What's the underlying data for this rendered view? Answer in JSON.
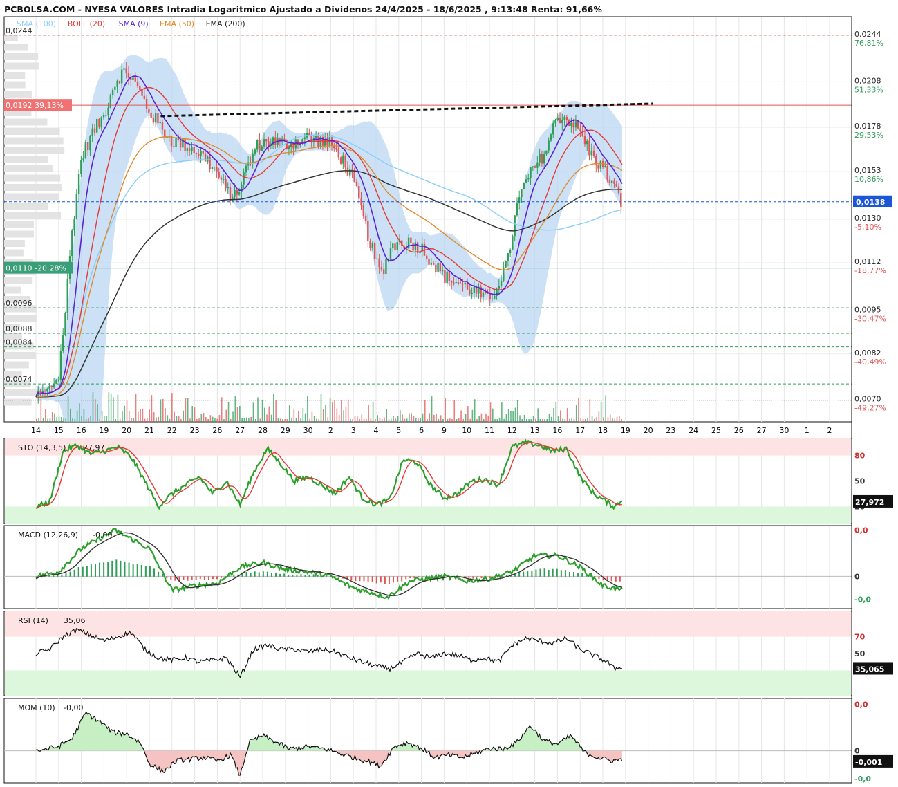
{
  "title": "PCBOLSA.COM - NYESA VALORES Intradia Logaritmico Ajustado a Dividenos 24/4/2025 - 18/6/2025 , 9:13:48 Renta: 91,66%",
  "colors": {
    "sma100": "#87cefa",
    "boll": "#e53935",
    "sma9": "#5b21d6",
    "ema50": "#e08a2a",
    "ema200": "#333333",
    "green": "#2e9e58",
    "red": "#e05555",
    "band": "#b7d4f2"
  },
  "legend": [
    {
      "text": "SMA (100)",
      "color": "#87cefa"
    },
    {
      "text": "BOLL (20)",
      "color": "#e53935"
    },
    {
      "text": "SMA (9)",
      "color": "#5b21d6"
    },
    {
      "text": "EMA (50)",
      "color": "#e08a2a"
    },
    {
      "text": "EMA (200)",
      "color": "#222222"
    }
  ],
  "chart_data": [
    {
      "type": "line",
      "name": "price",
      "scale": "log",
      "ylim": [
        0.0065,
        0.026
      ],
      "y_ticks": [
        {
          "value": 0.0244,
          "label": "0,0244",
          "pct": "76,81%",
          "pctColor": "#2e9e58"
        },
        {
          "value": 0.0208,
          "label": "0,0208",
          "pct": "51,33%",
          "pctColor": "#2e9e58"
        },
        {
          "value": 0.0178,
          "label": "0,0178",
          "pct": "29,53%",
          "pctColor": "#2e9e58"
        },
        {
          "value": 0.0153,
          "label": "0,0153",
          "pct": "10,86%",
          "pctColor": "#2e9e58"
        },
        {
          "value": 0.013,
          "label": "0,0130",
          "pct": "-5,10%",
          "pctColor": "#e05555"
        },
        {
          "value": 0.0112,
          "label": "0,0112",
          "pct": "-18,77%",
          "pctColor": "#e05555"
        },
        {
          "value": 0.0095,
          "label": "0,0095",
          "pct": "-30,47%",
          "pctColor": "#e05555"
        },
        {
          "value": 0.0082,
          "label": "0,0082",
          "pct": "-40,49%",
          "pctColor": "#e05555"
        },
        {
          "value": 0.007,
          "label": "0,0070",
          "pct": "-49,27%",
          "pctColor": "#e05555"
        }
      ],
      "left_levels": [
        {
          "value": 0.0244,
          "label": "0,0244",
          "style": "dash",
          "color": "#e05555"
        },
        {
          "value": 0.0096,
          "label": "0,0096",
          "style": "dash",
          "color": "#2e9e58"
        },
        {
          "value": 0.0088,
          "label": "0,0088",
          "style": "dash",
          "color": "#2e9e58"
        },
        {
          "value": 0.0084,
          "label": "0,0084",
          "style": "dash",
          "color": "#2e9e58"
        },
        {
          "value": 0.0074,
          "label": "0,0074",
          "style": "dash",
          "color": "#2e9e58"
        }
      ],
      "resistance": {
        "value": 0.0192,
        "label": "0,0192  39,13%",
        "color": "#e05555"
      },
      "support": {
        "value": 0.011,
        "label": "0,0110  -20,28%",
        "color": "#2e9e58"
      },
      "current": {
        "value": 0.0138,
        "label": "0,0138",
        "color": "#1a56d6"
      },
      "base": {
        "value": 0.007
      },
      "x_labels": [
        "14",
        "15",
        "16",
        "19",
        "20",
        "21",
        "22",
        "23",
        "26",
        "27",
        "28",
        "29",
        "30",
        "2",
        "3",
        "4",
        "5",
        "6",
        "9",
        "10",
        "11",
        "12",
        "13",
        "16",
        "17",
        "18",
        "19",
        "20",
        "23",
        "24",
        "25",
        "26",
        "27",
        "30",
        "1",
        "2"
      ],
      "last_data_index": 25,
      "close_keys": [
        [
          0,
          0.0071
        ],
        [
          0.5,
          0.0072
        ],
        [
          1.0,
          0.0076
        ],
        [
          1.3,
          0.0095
        ],
        [
          1.6,
          0.0125
        ],
        [
          2.0,
          0.016
        ],
        [
          2.5,
          0.0175
        ],
        [
          3.0,
          0.0185
        ],
        [
          3.4,
          0.0205
        ],
        [
          3.8,
          0.0215
        ],
        [
          4.2,
          0.0212
        ],
        [
          4.6,
          0.02
        ],
        [
          5.0,
          0.0188
        ],
        [
          5.5,
          0.0178
        ],
        [
          6.0,
          0.017
        ],
        [
          6.5,
          0.0168
        ],
        [
          7.0,
          0.0165
        ],
        [
          7.5,
          0.016
        ],
        [
          8.0,
          0.0152
        ],
        [
          8.4,
          0.0143
        ],
        [
          8.8,
          0.014
        ],
        [
          9.3,
          0.0155
        ],
        [
          9.8,
          0.0168
        ],
        [
          10.3,
          0.017
        ],
        [
          11.0,
          0.0168
        ],
        [
          11.5,
          0.017
        ],
        [
          12.0,
          0.0172
        ],
        [
          12.5,
          0.017
        ],
        [
          13.0,
          0.0168
        ],
        [
          13.5,
          0.016
        ],
        [
          14.0,
          0.0148
        ],
        [
          14.5,
          0.0128
        ],
        [
          15.0,
          0.0112
        ],
        [
          15.3,
          0.0107
        ],
        [
          15.6,
          0.0118
        ],
        [
          16.0,
          0.012
        ],
        [
          16.5,
          0.012
        ],
        [
          17.0,
          0.0118
        ],
        [
          17.5,
          0.0112
        ],
        [
          18.0,
          0.0107
        ],
        [
          18.5,
          0.0105
        ],
        [
          19.0,
          0.0103
        ],
        [
          19.5,
          0.0101
        ],
        [
          20.0,
          0.0098
        ],
        [
          20.4,
          0.0105
        ],
        [
          20.8,
          0.0112
        ],
        [
          21.2,
          0.0135
        ],
        [
          21.6,
          0.0148
        ],
        [
          22.0,
          0.0155
        ],
        [
          22.5,
          0.0165
        ],
        [
          23.0,
          0.0185
        ],
        [
          23.5,
          0.0183
        ],
        [
          24.0,
          0.0175
        ],
        [
          24.5,
          0.0162
        ],
        [
          25.0,
          0.0155
        ],
        [
          25.5,
          0.0145
        ],
        [
          25.8,
          0.0138
        ]
      ],
      "dashed_trend": [
        [
          5.5,
          0.0185
        ],
        [
          27.2,
          0.0193
        ]
      ]
    },
    {
      "type": "line",
      "name": "STO (14,3,5)",
      "label": "STO (14,3,5)",
      "value_text": "27,97",
      "current": "27,972",
      "ylim": [
        0,
        100
      ],
      "zones": [
        [
          80,
          100,
          "#fde3e3"
        ],
        [
          0,
          20,
          "#ddf7dc"
        ]
      ],
      "ticks": [
        {
          "v": 80,
          "label": "80",
          "color": "#d32f2f"
        },
        {
          "v": 50,
          "label": "50",
          "color": "#333"
        },
        {
          "v": 20,
          "label": "20",
          "color": "#333"
        }
      ],
      "keys": [
        [
          0,
          20
        ],
        [
          0.6,
          25
        ],
        [
          1.2,
          85
        ],
        [
          1.8,
          92
        ],
        [
          2.4,
          82
        ],
        [
          3.0,
          85
        ],
        [
          3.6,
          90
        ],
        [
          4.2,
          78
        ],
        [
          4.8,
          50
        ],
        [
          5.4,
          20
        ],
        [
          6,
          35
        ],
        [
          6.6,
          45
        ],
        [
          7.2,
          55
        ],
        [
          7.8,
          35
        ],
        [
          8.4,
          50
        ],
        [
          9,
          22
        ],
        [
          9.6,
          60
        ],
        [
          10.2,
          88
        ],
        [
          10.8,
          70
        ],
        [
          11.4,
          50
        ],
        [
          12,
          55
        ],
        [
          12.6,
          45
        ],
        [
          13.2,
          35
        ],
        [
          13.8,
          55
        ],
        [
          14.4,
          30
        ],
        [
          15,
          22
        ],
        [
          15.6,
          28
        ],
        [
          16.2,
          75
        ],
        [
          16.8,
          72
        ],
        [
          17.4,
          45
        ],
        [
          18,
          30
        ],
        [
          18.6,
          35
        ],
        [
          19.2,
          50
        ],
        [
          19.8,
          52
        ],
        [
          20.4,
          45
        ],
        [
          21,
          90
        ],
        [
          21.6,
          95
        ],
        [
          22.2,
          92
        ],
        [
          22.8,
          85
        ],
        [
          23.4,
          88
        ],
        [
          24,
          55
        ],
        [
          24.6,
          35
        ],
        [
          25.2,
          25
        ],
        [
          25.5,
          20
        ],
        [
          25.9,
          28
        ]
      ],
      "signal_lag": 0.25
    },
    {
      "type": "line",
      "name": "MACD (12,26,9)",
      "label": "MACD (12,26,9)",
      "value_text": "-0,00",
      "ylim": [
        -0.0007,
        0.0011
      ],
      "ticks": [
        {
          "v": 0.001,
          "label": "0,0",
          "color": "#d32f2f"
        },
        {
          "v": 0,
          "label": "0",
          "color": "#333"
        },
        {
          "v": -0.0005,
          "label": "-0,0",
          "color": "#2e9e58"
        }
      ],
      "keys": [
        [
          0,
          0
        ],
        [
          1,
          0.0001
        ],
        [
          2,
          0.0006
        ],
        [
          3.5,
          0.001
        ],
        [
          5,
          0.0006
        ],
        [
          6,
          -0.0003
        ],
        [
          7,
          -0.0002
        ],
        [
          8,
          -0.00015
        ],
        [
          9,
          0.0002
        ],
        [
          10,
          0.0003
        ],
        [
          11,
          0.00015
        ],
        [
          12,
          0.0001
        ],
        [
          13,
          0
        ],
        [
          14,
          -0.00025
        ],
        [
          15.5,
          -0.00045
        ],
        [
          16.5,
          -0.0001
        ],
        [
          18,
          0
        ],
        [
          19,
          -0.0001
        ],
        [
          20,
          -5e-05
        ],
        [
          21,
          0.0001
        ],
        [
          22,
          0.00045
        ],
        [
          23,
          0.00045
        ],
        [
          24,
          0.0002
        ],
        [
          25,
          -0.0002
        ],
        [
          25.9,
          -0.0003
        ]
      ],
      "signal_lag": 0.45
    },
    {
      "type": "line",
      "name": "RSI (14)",
      "label": "RSI (14)",
      "value_text": "35,06",
      "current": "35,065",
      "ylim": [
        0,
        100
      ],
      "zones": [
        [
          70,
          100,
          "#fde3e3"
        ],
        [
          0,
          30,
          "#ddf7dc"
        ]
      ],
      "ticks": [
        {
          "v": 70,
          "label": "70",
          "color": "#d32f2f"
        },
        {
          "v": 50,
          "label": "50",
          "color": "#333"
        },
        {
          "v": 30,
          "label": "30",
          "color": "#333"
        }
      ],
      "keys": [
        [
          0,
          50
        ],
        [
          0.6,
          55
        ],
        [
          1.2,
          70
        ],
        [
          1.8,
          78
        ],
        [
          2.4,
          72
        ],
        [
          3,
          65
        ],
        [
          3.6,
          70
        ],
        [
          4.2,
          75
        ],
        [
          4.8,
          55
        ],
        [
          5.4,
          45
        ],
        [
          6,
          42
        ],
        [
          6.6,
          45
        ],
        [
          7.2,
          40
        ],
        [
          7.8,
          42
        ],
        [
          8.4,
          45
        ],
        [
          9,
          22
        ],
        [
          9.6,
          55
        ],
        [
          10.2,
          60
        ],
        [
          10.8,
          55
        ],
        [
          11.4,
          55
        ],
        [
          12,
          52
        ],
        [
          12.6,
          55
        ],
        [
          13.2,
          52
        ],
        [
          13.8,
          45
        ],
        [
          14.4,
          40
        ],
        [
          15,
          35
        ],
        [
          15.6,
          32
        ],
        [
          16.2,
          40
        ],
        [
          16.8,
          50
        ],
        [
          17.4,
          45
        ],
        [
          18,
          50
        ],
        [
          18.6,
          48
        ],
        [
          19.2,
          42
        ],
        [
          19.8,
          45
        ],
        [
          20.4,
          40
        ],
        [
          21,
          60
        ],
        [
          21.6,
          68
        ],
        [
          22.2,
          65
        ],
        [
          22.8,
          62
        ],
        [
          23.4,
          68
        ],
        [
          24,
          55
        ],
        [
          24.6,
          48
        ],
        [
          25.2,
          40
        ],
        [
          25.5,
          32
        ],
        [
          25.9,
          35
        ]
      ]
    },
    {
      "type": "line",
      "name": "MOM (10)",
      "label": "MOM (10)",
      "value_text": "-0,00",
      "current": "-0,001",
      "ylim": [
        -0.0038,
        0.0062
      ],
      "ticks": [
        {
          "v": 0.0055,
          "label": "0,0",
          "color": "#d32f2f"
        },
        {
          "v": 0,
          "label": "0",
          "color": "#333"
        },
        {
          "v": -0.0033,
          "label": "-0,0",
          "color": "#2e9e58"
        }
      ],
      "keys": [
        [
          0,
          0
        ],
        [
          1,
          0.0005
        ],
        [
          1.6,
          0.0015
        ],
        [
          2.2,
          0.0045
        ],
        [
          2.8,
          0.0035
        ],
        [
          3.4,
          0.0022
        ],
        [
          4,
          0.002
        ],
        [
          4.6,
          0.001
        ],
        [
          5,
          -0.0015
        ],
        [
          5.6,
          -0.0025
        ],
        [
          6.2,
          -0.0012
        ],
        [
          6.8,
          -0.001
        ],
        [
          7.4,
          -0.0008
        ],
        [
          8,
          -0.0012
        ],
        [
          8.6,
          -0.0005
        ],
        [
          9,
          -0.003
        ],
        [
          9.4,
          0.001
        ],
        [
          10,
          0.0018
        ],
        [
          10.6,
          0.001
        ],
        [
          11.2,
          0.0002
        ],
        [
          12,
          0.0005
        ],
        [
          12.8,
          0.0002
        ],
        [
          13.4,
          -0.0003
        ],
        [
          14,
          -0.0008
        ],
        [
          14.6,
          -0.0012
        ],
        [
          15.2,
          -0.0018
        ],
        [
          15.8,
          0.0005
        ],
        [
          16.4,
          0.001
        ],
        [
          17,
          0.0003
        ],
        [
          17.6,
          -0.0008
        ],
        [
          18.2,
          -0.0005
        ],
        [
          18.8,
          -0.0008
        ],
        [
          19.4,
          -0.0003
        ],
        [
          20,
          0.0003
        ],
        [
          20.6,
          0.0002
        ],
        [
          21.2,
          0.001
        ],
        [
          21.8,
          0.003
        ],
        [
          22.4,
          0.0012
        ],
        [
          23,
          0.0008
        ],
        [
          23.6,
          0.0018
        ],
        [
          24.2,
          -0.0002
        ],
        [
          24.8,
          -0.0008
        ],
        [
          25.4,
          -0.0012
        ],
        [
          25.9,
          -0.001
        ]
      ]
    }
  ]
}
